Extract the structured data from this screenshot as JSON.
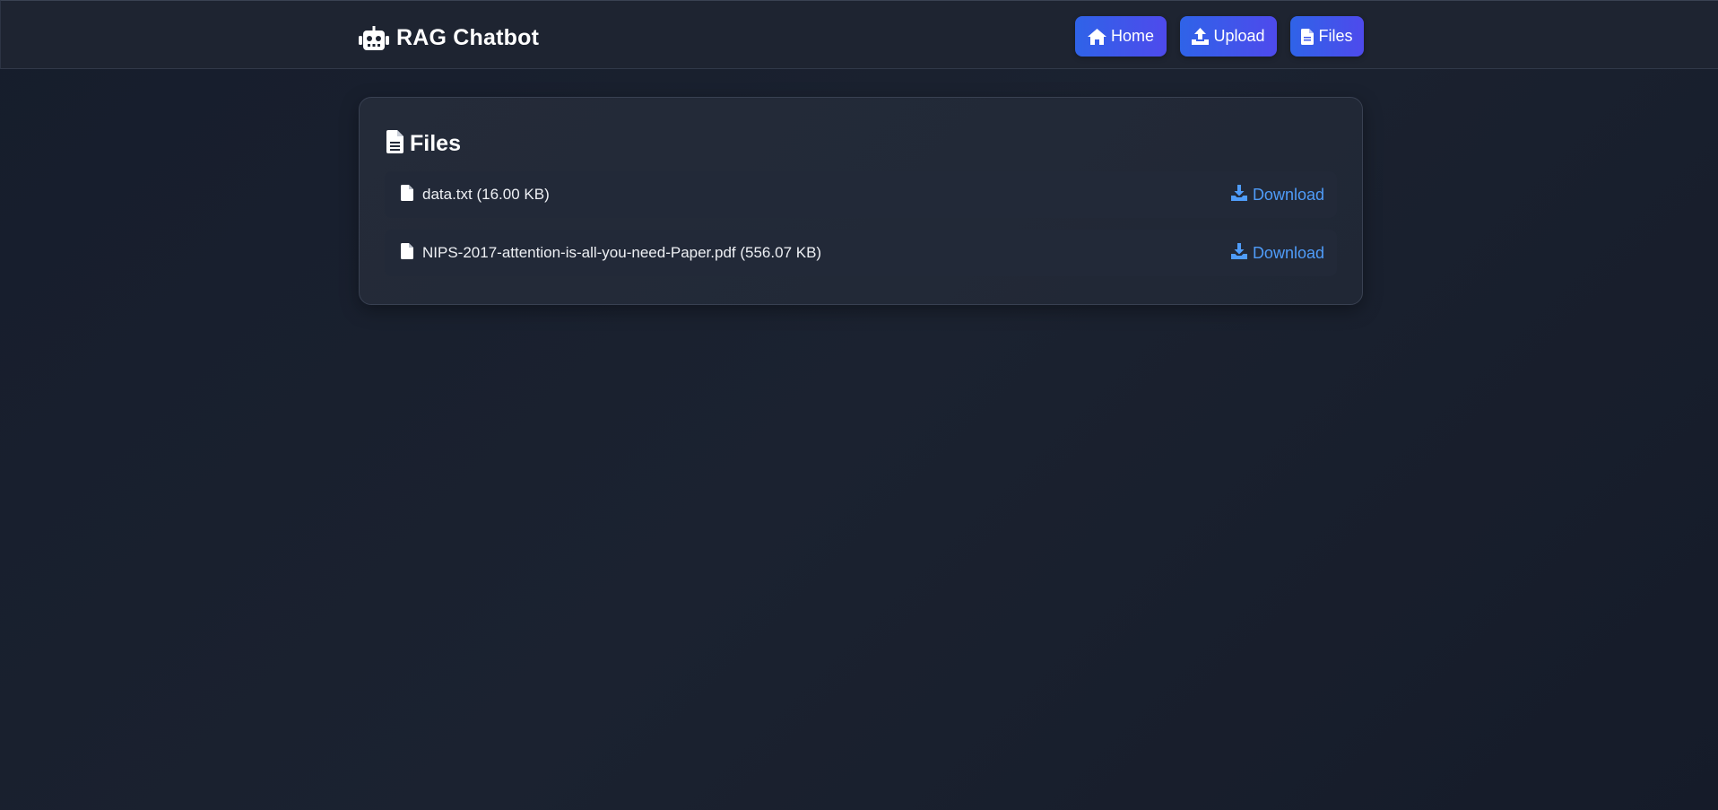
{
  "header": {
    "brand_title": "RAG Chatbot",
    "brand_icon": "robot-icon",
    "nav": [
      {
        "label": "Home",
        "icon": "home-icon"
      },
      {
        "label": "Upload",
        "icon": "upload-icon"
      },
      {
        "label": "Files",
        "icon": "file-icon"
      }
    ]
  },
  "files_card": {
    "title": "Files",
    "title_icon": "file-lines-icon",
    "files": [
      {
        "name": "data.txt (16.00 KB)",
        "action": "Download"
      },
      {
        "name": "NIPS-2017-attention-is-all-you-need-Paper.pdf (556.07 KB)",
        "action": "Download"
      }
    ]
  },
  "colors": {
    "background": "#181f2d",
    "navbar": "#1e2431",
    "button_start": "#2f63e8",
    "button_end": "#4e4aec",
    "link": "#4f9cf9"
  }
}
